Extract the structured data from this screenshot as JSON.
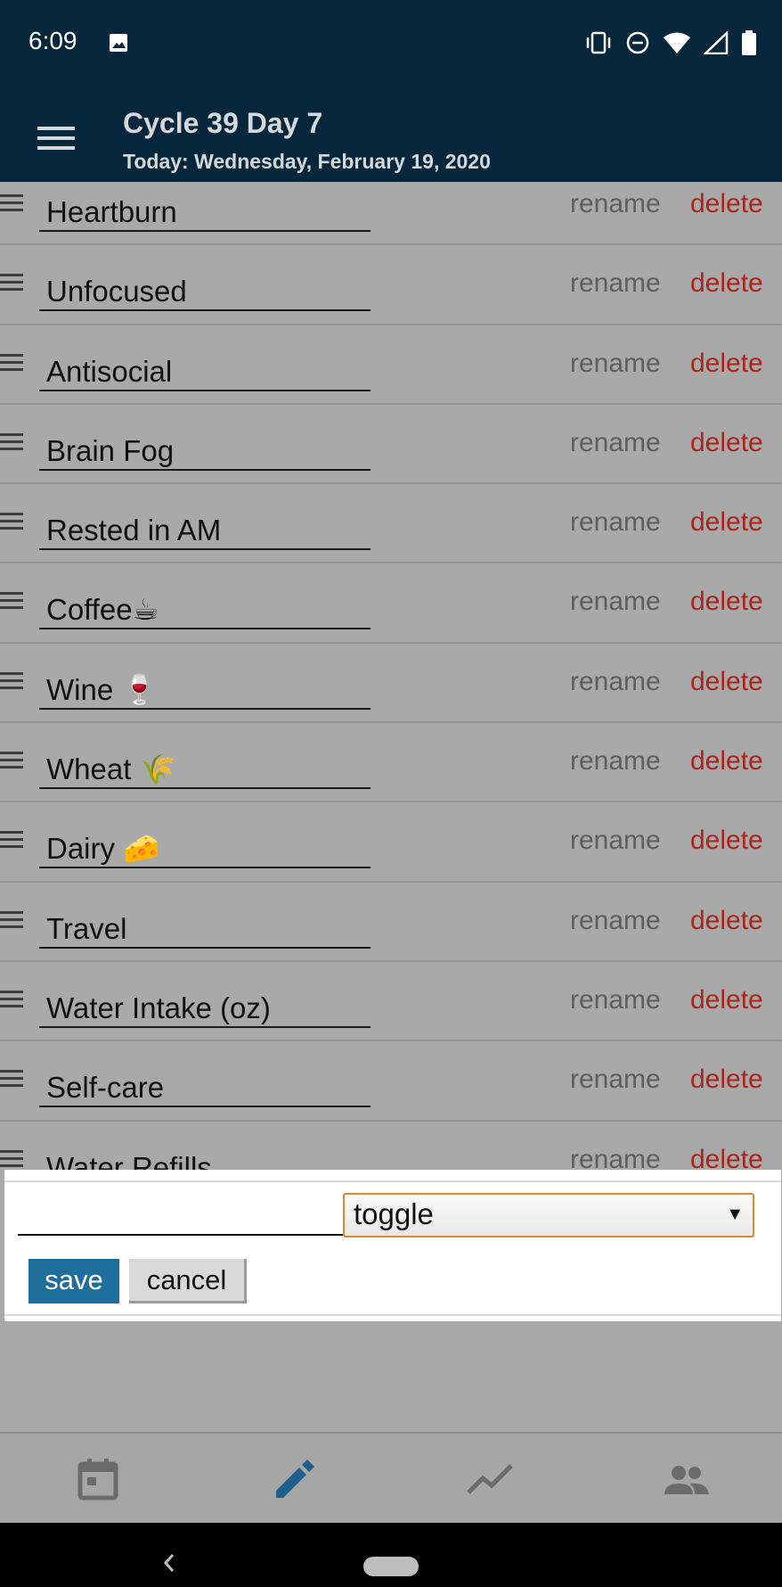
{
  "status_bar": {
    "time": "6:09",
    "icons": [
      "image-icon",
      "vibrate-icon",
      "do-not-disturb-icon",
      "wifi-icon",
      "cellular-signal-icon",
      "battery-icon"
    ]
  },
  "header": {
    "title": "Cycle 39 Day 7",
    "subtitle": "Today: Wednesday, February 19, 2020",
    "menu_icon": "hamburger-menu-icon"
  },
  "tags": [
    {
      "name": "Heartburn",
      "rename": "rename",
      "delete": "delete"
    },
    {
      "name": "Unfocused",
      "rename": "rename",
      "delete": "delete"
    },
    {
      "name": "Antisocial",
      "rename": "rename",
      "delete": "delete"
    },
    {
      "name": "Brain Fog",
      "rename": "rename",
      "delete": "delete"
    },
    {
      "name": "Rested in AM",
      "rename": "rename",
      "delete": "delete"
    },
    {
      "name": "Coffee☕",
      "rename": "rename",
      "delete": "delete"
    },
    {
      "name": "Wine 🍷",
      "rename": "rename",
      "delete": "delete"
    },
    {
      "name": "Wheat 🌾",
      "rename": "rename",
      "delete": "delete"
    },
    {
      "name": "Dairy 🧀",
      "rename": "rename",
      "delete": "delete"
    },
    {
      "name": "Travel",
      "rename": "rename",
      "delete": "delete"
    },
    {
      "name": "Water Intake (oz)",
      "rename": "rename",
      "delete": "delete"
    },
    {
      "name": "Self-care",
      "rename": "rename",
      "delete": "delete"
    },
    {
      "name": "Water Refills",
      "rename": "rename",
      "delete": "delete"
    }
  ],
  "add_form": {
    "name_value": "",
    "type_selected": "toggle",
    "save_label": "save",
    "cancel_label": "cancel"
  },
  "bottom_nav": {
    "items": [
      "calendar-icon",
      "edit-pencil-icon",
      "trends-chart-icon",
      "people-icon"
    ],
    "active": "edit-pencil-icon"
  },
  "colors": {
    "header_bg": "#05263b",
    "delete": "#a8251c",
    "rename": "#5e5e5e",
    "save_button": "#1f6f9c",
    "active_nav": "#1f5f8c",
    "select_border": "#e08a2c"
  }
}
